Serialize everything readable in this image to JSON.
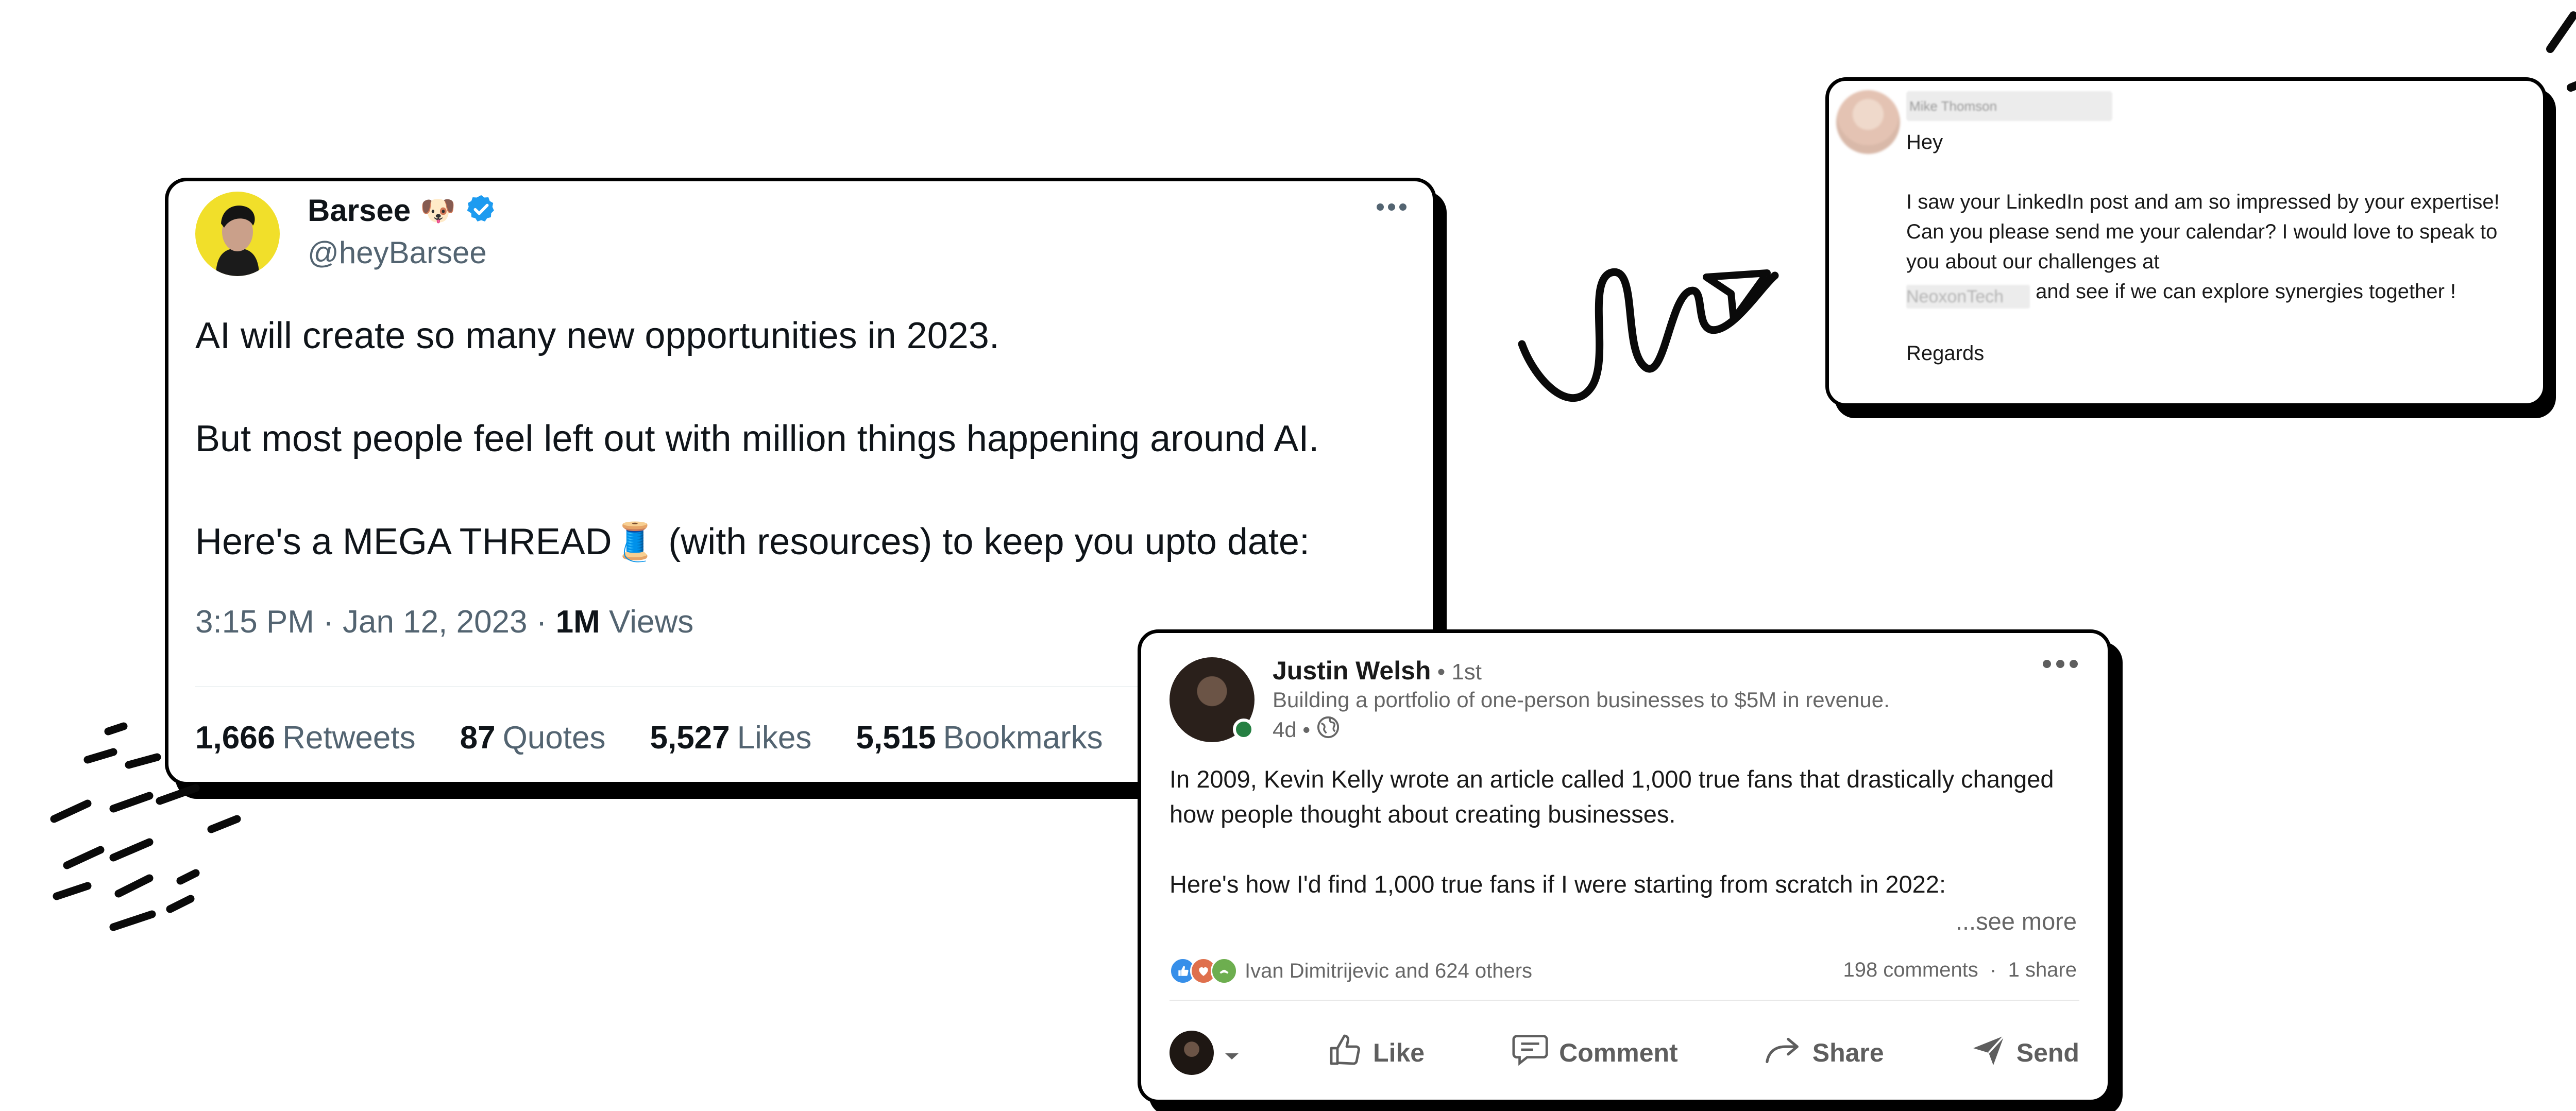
{
  "tweet": {
    "name": "Barsee",
    "emoji": "🐶",
    "handle": "@heyBarsee",
    "paragraphs": [
      "AI will create so many new opportunities in 2023.",
      "But most people feel left out with million things happening around AI.",
      "Here's a MEGA THREAD🧵 (with resources) to keep you upto date:"
    ],
    "time": "3:15 PM · Jan 12, 2023 · ",
    "views_count": "1M",
    "views_label": " Views",
    "stats": [
      {
        "count": "1,666",
        "label": "Retweets"
      },
      {
        "count": "87",
        "label": "Quotes"
      },
      {
        "count": "5,527",
        "label": "Likes"
      },
      {
        "count": "5,515",
        "label": "Bookmarks"
      }
    ],
    "colors": {
      "verified": "#1d9bf0",
      "avatar_bg": "#f1df2a"
    }
  },
  "message": {
    "sender_blurred": "Mike Thomson",
    "greeting": "Hey",
    "line1": "I saw your LinkedIn post and am so impressed by your expertise! Can you please send me your calendar? I would love to speak to you about our challenges at",
    "company_blurred": "NeoxonTech",
    "line2": "and see if we can explore synergies together !",
    "closing": "Regards"
  },
  "post": {
    "name": "Justin Welsh",
    "degree": " • 1st",
    "headline": "Building a portfolio of one-person businesses to $5M in revenue.",
    "time": "4d •",
    "paragraphs": [
      "In 2009, Kevin Kelly wrote an article called 1,000 true fans that drastically changed how people thought about creating businesses.",
      "Here's how I'd find 1,000 true fans if I were starting from scratch in 2022:"
    ],
    "see_more": "...see more",
    "reactions_text": "Ivan Dimitrijevic and 624 others",
    "comments": "198 comments",
    "shares": "1 share",
    "actions": {
      "like": "Like",
      "comment": "Comment",
      "share": "Share",
      "send": "Send"
    },
    "colors": {
      "online": "#268043",
      "like": "#378fe9",
      "love": "#df704d",
      "support": "#6dae4f"
    }
  }
}
